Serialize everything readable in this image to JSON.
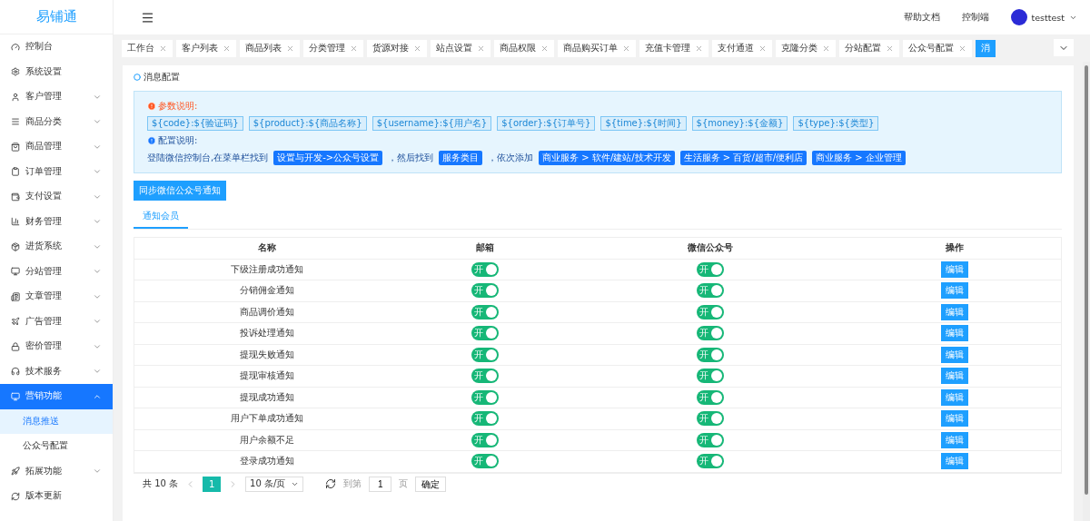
{
  "brand": "易铺通",
  "header": {
    "links": [
      "帮助文档",
      "控制端"
    ],
    "user": "testtest"
  },
  "sidebar": {
    "items": [
      {
        "label": "控制台",
        "selected": false
      },
      {
        "label": "系统设置",
        "selected": false
      },
      {
        "label": "客户管理",
        "expanded": false,
        "selected": false
      },
      {
        "label": "商品分类",
        "expanded": false,
        "selected": false
      },
      {
        "label": "商品管理",
        "expanded": false,
        "selected": false
      },
      {
        "label": "订单管理",
        "expanded": false,
        "selected": false
      },
      {
        "label": "支付设置",
        "expanded": false,
        "selected": false
      },
      {
        "label": "财务管理",
        "expanded": false,
        "selected": false
      },
      {
        "label": "进货系统",
        "expanded": false,
        "selected": false
      },
      {
        "label": "分站管理",
        "expanded": false,
        "selected": false
      },
      {
        "label": "文章管理",
        "expanded": false,
        "selected": false
      },
      {
        "label": "广告管理",
        "expanded": false,
        "selected": false
      },
      {
        "label": "密价管理",
        "expanded": false,
        "selected": false
      },
      {
        "label": "技术服务",
        "expanded": false,
        "selected": false
      },
      {
        "label": "营销功能",
        "expanded": true,
        "selected": true,
        "children": [
          {
            "label": "消息推送",
            "selected": true
          },
          {
            "label": "公众号配置",
            "selected": false
          }
        ]
      },
      {
        "label": "拓展功能",
        "expanded": false,
        "selected": false
      },
      {
        "label": "版本更新",
        "selected": false
      }
    ]
  },
  "tabs": [
    {
      "label": "工作台",
      "selected": false
    },
    {
      "label": "客户列表",
      "selected": false
    },
    {
      "label": "商品列表",
      "selected": false
    },
    {
      "label": "分类管理",
      "selected": false
    },
    {
      "label": "货源对接",
      "selected": false
    },
    {
      "label": "站点设置",
      "selected": false
    },
    {
      "label": "商品权限",
      "selected": false
    },
    {
      "label": "商品购买订单",
      "selected": false
    },
    {
      "label": "充值卡管理",
      "selected": false
    },
    {
      "label": "支付通道",
      "selected": false
    },
    {
      "label": "克隆分类",
      "selected": false
    },
    {
      "label": "分站配置",
      "selected": false
    },
    {
      "label": "公众号配置",
      "selected": false
    },
    {
      "label": "消",
      "selected": true
    }
  ],
  "page_title": "消息配置",
  "params": {
    "title": "参数说明:",
    "tags": [
      "${code}:${验证码}",
      "${product}:${商品名称}",
      "${username}:${用户名}",
      "${order}:${订单号}",
      "${time}:${时间}",
      "${money}:${金额}",
      "${type}:${类型}"
    ]
  },
  "config": {
    "title": "配置说明:",
    "parts": [
      {
        "kind": "text",
        "text": "登陆微信控制台,在菜单栏找到"
      },
      {
        "kind": "tag",
        "text": "设置与开发->公众号设置"
      },
      {
        "kind": "text",
        "text": "，然后找到"
      },
      {
        "kind": "tag",
        "text": "服务类目"
      },
      {
        "kind": "text",
        "text": "，依次添加"
      },
      {
        "kind": "tag",
        "text": "商业服务 > 软件/建站/技术开发"
      },
      {
        "kind": "tag",
        "text": "生活服务 > 百货/超市/便利店"
      },
      {
        "kind": "tag",
        "text": "商业服务 > 企业管理"
      }
    ]
  },
  "sync_button": "同步微信公众号通知",
  "subtabs": [
    {
      "label": "通知会员",
      "selected": true
    }
  ],
  "table": {
    "columns": [
      "名称",
      "邮箱",
      "微信公众号",
      "操作"
    ],
    "rows": [
      {
        "name": "下级注册成功通知",
        "email": {
          "on": true,
          "text": "开"
        },
        "wechat": {
          "on": true,
          "text": "开"
        },
        "action": "编辑"
      },
      {
        "name": "分销佣金通知",
        "email": {
          "on": true,
          "text": "开"
        },
        "wechat": {
          "on": true,
          "text": "开"
        },
        "action": "编辑"
      },
      {
        "name": "商品调价通知",
        "email": {
          "on": true,
          "text": "开"
        },
        "wechat": {
          "on": true,
          "text": "开"
        },
        "action": "编辑"
      },
      {
        "name": "投诉处理通知",
        "email": {
          "on": true,
          "text": "开"
        },
        "wechat": {
          "on": true,
          "text": "开"
        },
        "action": "编辑"
      },
      {
        "name": "提现失败通知",
        "email": {
          "on": true,
          "text": "开"
        },
        "wechat": {
          "on": true,
          "text": "开"
        },
        "action": "编辑"
      },
      {
        "name": "提现审核通知",
        "email": {
          "on": true,
          "text": "开"
        },
        "wechat": {
          "on": true,
          "text": "开"
        },
        "action": "编辑"
      },
      {
        "name": "提现成功通知",
        "email": {
          "on": true,
          "text": "开"
        },
        "wechat": {
          "on": true,
          "text": "开"
        },
        "action": "编辑"
      },
      {
        "name": "用户下单成功通知",
        "email": {
          "on": true,
          "text": "开"
        },
        "wechat": {
          "on": true,
          "text": "开"
        },
        "action": "编辑"
      },
      {
        "name": "用户余额不足",
        "email": {
          "on": true,
          "text": "开"
        },
        "wechat": {
          "on": true,
          "text": "开"
        },
        "action": "编辑"
      },
      {
        "name": "登录成功通知",
        "email": {
          "on": true,
          "text": "开"
        },
        "wechat": {
          "on": true,
          "text": "开"
        },
        "action": "编辑"
      }
    ]
  },
  "pagination": {
    "total": "共 10 条",
    "pages": [
      {
        "label": "1",
        "selected": true
      }
    ],
    "page_size": "10 条/页",
    "goto_label": "到第",
    "goto_value": "1",
    "page_unit": "页",
    "confirm": "确定"
  }
}
